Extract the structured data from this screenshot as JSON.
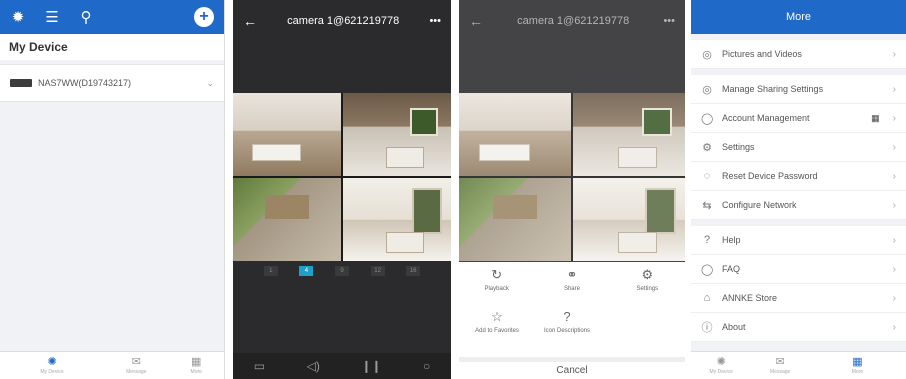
{
  "panel1": {
    "title": "My Device",
    "device_name": "NAS7WW(D19743217)",
    "toolbar_icons": [
      "settings-icon",
      "list-icon",
      "search-icon"
    ],
    "nav": [
      {
        "label": "My Device",
        "icon": "devices-icon",
        "active": true
      },
      {
        "label": "Message",
        "icon": "message-icon",
        "active": false
      },
      {
        "label": "More",
        "icon": "more-icon",
        "active": false
      }
    ]
  },
  "panel2": {
    "camera_title": "camera 1@621219778",
    "more": "•••",
    "splits": [
      "1",
      "4",
      "9",
      "12",
      "16"
    ],
    "active_split": "4"
  },
  "panel3": {
    "camera_title": "camera 1@621219778",
    "more": "•••",
    "actions_row1": [
      {
        "label": "Playback",
        "icon": "playback-icon"
      },
      {
        "label": "Share",
        "icon": "share-icon"
      },
      {
        "label": "Settings",
        "icon": "settings-icon"
      }
    ],
    "actions_row2": [
      {
        "label": "Add to Favorites",
        "icon": "star-icon"
      },
      {
        "label": "Icon Descriptions",
        "icon": "help-icon"
      }
    ],
    "cancel": "Cancel"
  },
  "panel4": {
    "title": "More",
    "group1": [
      {
        "label": "Pictures and Videos",
        "icon": "pictures-icon"
      }
    ],
    "group2": [
      {
        "label": "Manage Sharing Settings",
        "icon": "sharing-icon"
      },
      {
        "label": "Account Management",
        "icon": "account-icon"
      },
      {
        "label": "Settings",
        "icon": "settings-icon"
      },
      {
        "label": "Reset Device Password",
        "icon": "reset-icon"
      },
      {
        "label": "Configure Network",
        "icon": "network-icon"
      }
    ],
    "group3": [
      {
        "label": "Help",
        "icon": "help-icon"
      },
      {
        "label": "FAQ",
        "icon": "faq-icon"
      },
      {
        "label": "ANNKE Store",
        "icon": "store-icon"
      },
      {
        "label": "About",
        "icon": "about-icon"
      }
    ],
    "nav": [
      {
        "label": "My Device",
        "icon": "devices-icon",
        "active": false
      },
      {
        "label": "Message",
        "icon": "message-icon",
        "active": false
      },
      {
        "label": "More",
        "icon": "more-icon",
        "active": true
      }
    ]
  },
  "colors": {
    "brand_blue": "#1f69c9",
    "active_split": "#1ca2c9"
  }
}
